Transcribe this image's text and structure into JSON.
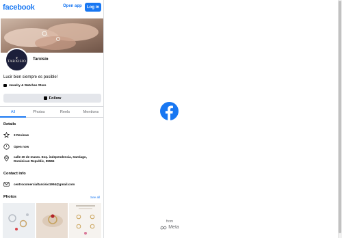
{
  "header": {
    "brand": "facebook",
    "open_app": "Open app",
    "login": "Log in"
  },
  "profile": {
    "avatar_text": "TARXISIO",
    "name": "Tarxisio",
    "bio": "Lucir bien siempre es posible!",
    "category": "Jewelry & Watches Store",
    "follow": "Follow"
  },
  "tabs": [
    {
      "label": "All",
      "active": true
    },
    {
      "label": "Photos",
      "active": false
    },
    {
      "label": "Reels",
      "active": false
    },
    {
      "label": "Mentions",
      "active": false
    }
  ],
  "details": {
    "title": "Details",
    "reviews": "3 Reviews",
    "hours": "Open now",
    "address_line1": "calle 30 de marzo. Esq. independencia, Santiago,",
    "address_line2": "Dominican Republic, 55555"
  },
  "contact": {
    "title": "Contact info",
    "email": "centrocomercialtarxisio1994@gmail.com"
  },
  "photos": {
    "title": "Photos",
    "see_all": "See all"
  },
  "splash": {
    "from": "from",
    "meta": "Meta"
  },
  "colors": {
    "brand_blue": "#1877f2",
    "text": "#050505",
    "secondary_text": "#65676b",
    "button_gray": "#e4e6eb"
  },
  "icons": [
    "facebook-wordmark",
    "category-icon",
    "follow-icon",
    "star-icon",
    "clock-icon",
    "location-pin-icon",
    "mail-icon",
    "facebook-logo-icon",
    "meta-logo-icon"
  ]
}
